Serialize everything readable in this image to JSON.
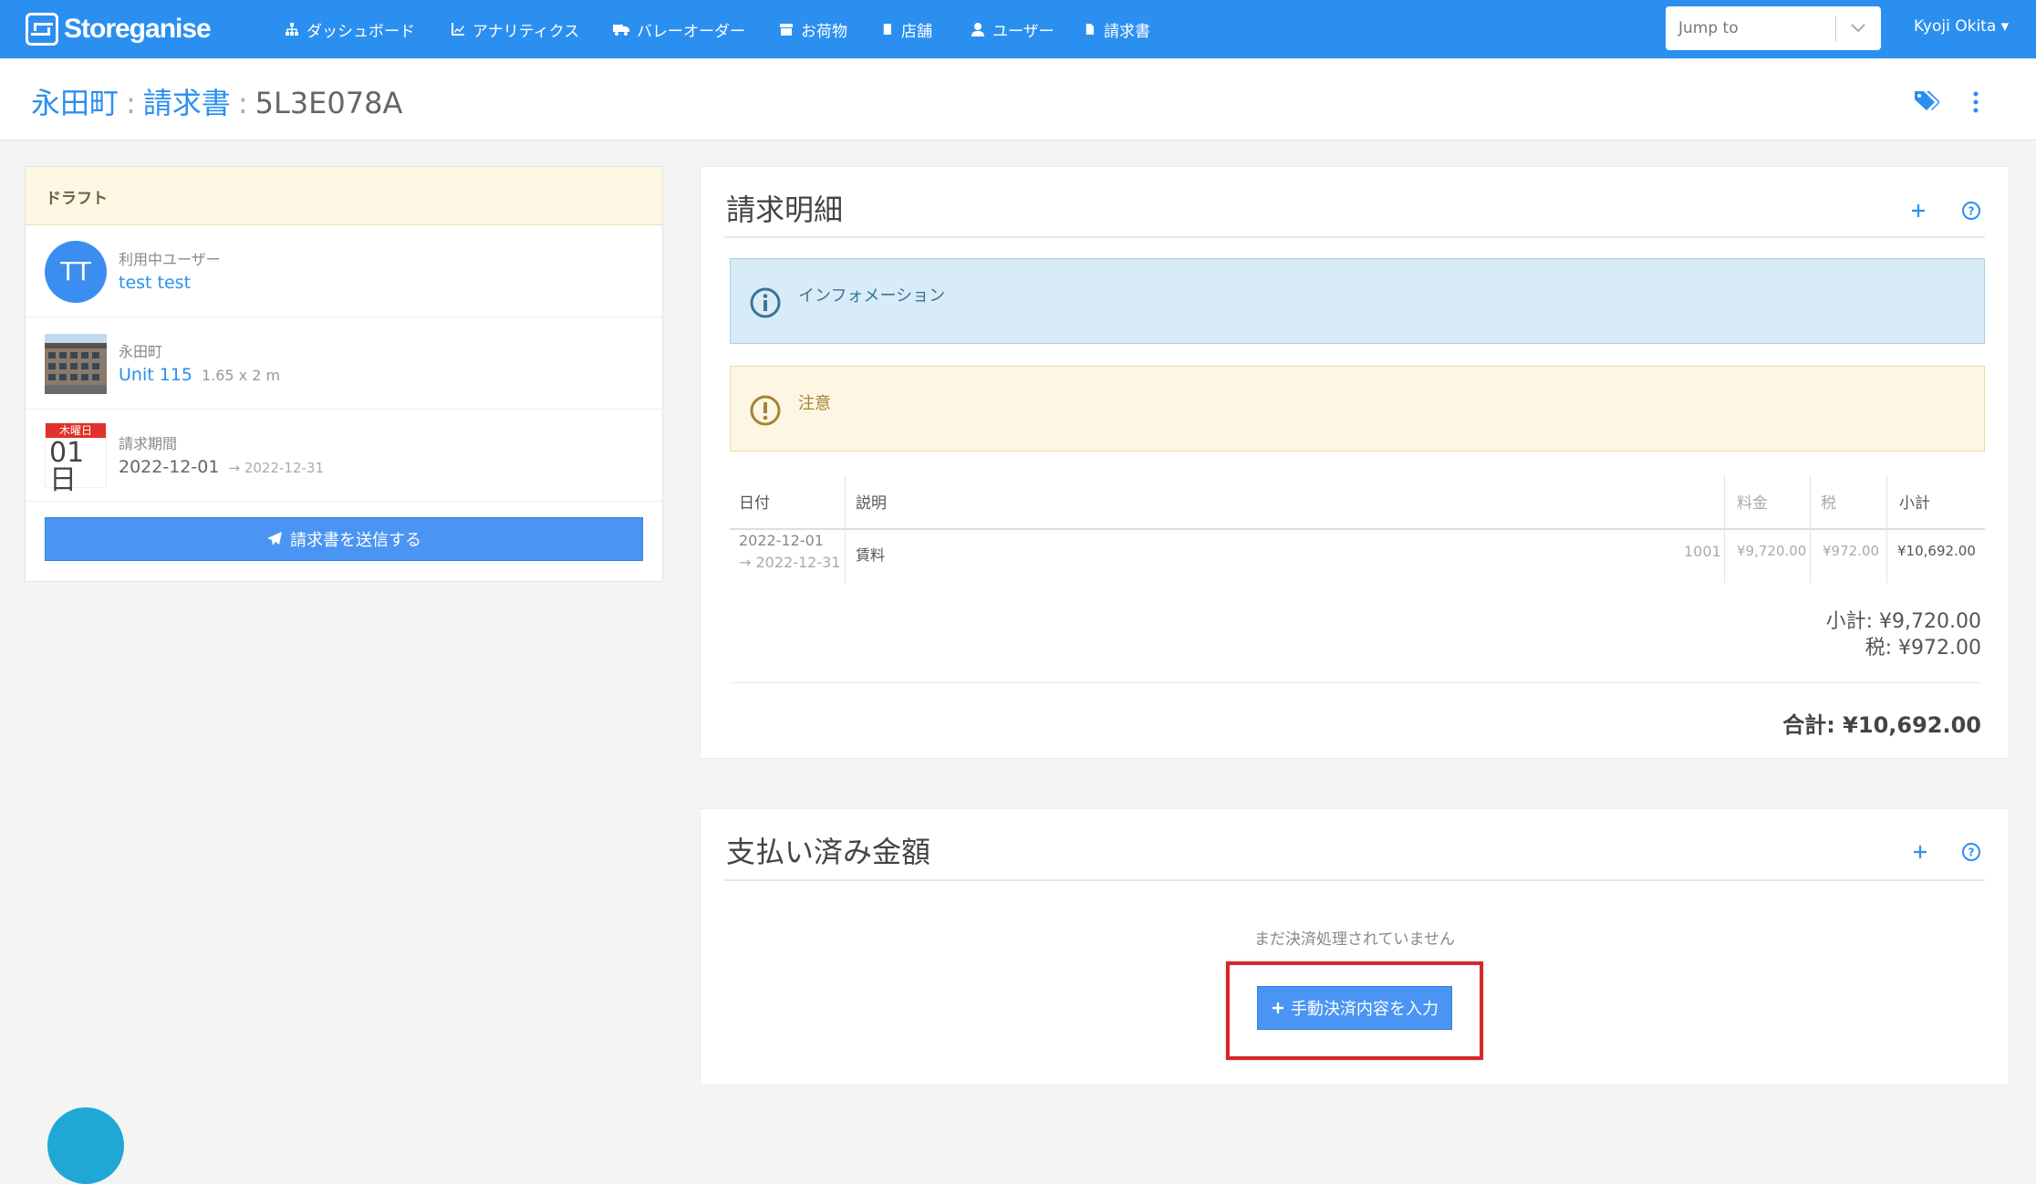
{
  "brand": "Storeganise",
  "nav": [
    {
      "label": "ダッシュボード",
      "icon": "sitemap-icon"
    },
    {
      "label": "アナリティクス",
      "icon": "line-chart-icon"
    },
    {
      "label": "バレーオーダー",
      "icon": "truck-icon"
    },
    {
      "label": "お荷物",
      "icon": "archive-icon"
    },
    {
      "label": "店舗",
      "icon": "building-icon"
    },
    {
      "label": "ユーザー",
      "icon": "user-icon"
    },
    {
      "label": "請求書",
      "icon": "file-icon"
    }
  ],
  "jump": {
    "placeholder": "Jump to"
  },
  "user_menu": {
    "name": "Kyoji Okita",
    "caret": "▾"
  },
  "header": {
    "site": "永田町",
    "sep": ":",
    "section": "請求書",
    "invoice_id": "5L3E078A"
  },
  "left": {
    "status": "ドラフト",
    "customer": {
      "initials": "TT",
      "label": "利用中ユーザー",
      "name": "test test"
    },
    "unit": {
      "site": "永田町",
      "name": "Unit 115",
      "size": "1.65 x 2 m"
    },
    "period": {
      "weekday": "木曜日",
      "day": "01",
      "day_suffix": "日",
      "label": "請求期間",
      "start": "2022-12-01",
      "arrow": "→",
      "end": "2022-12-31"
    },
    "send_button": "請求書を送信する"
  },
  "lines_panel": {
    "title": "請求明細",
    "info": "インフォメーション",
    "warning": "注意",
    "columns": {
      "date": "日付",
      "desc": "説明",
      "fee": "料金",
      "tax": "税",
      "subtotal": "小計"
    },
    "row": {
      "start": "2022-12-01",
      "end": "→ 2022-12-31",
      "desc": "賃料",
      "code": "1001",
      "fee": "¥9,720.00",
      "tax": "¥972.00",
      "subtotal": "¥10,692.00"
    },
    "subtotal": "小計: ¥9,720.00",
    "tax": "税: ¥972.00",
    "total": "合計: ¥10,692.00"
  },
  "payments_panel": {
    "title": "支払い済み金額",
    "empty": "まだ決済処理されていません",
    "manual_button": "手動決済内容を入力"
  },
  "colors": {
    "primary": "#2b8ff0",
    "danger": "#d9262c",
    "info_bg": "#d8ecf7",
    "warn_bg": "#fdf6e3"
  }
}
